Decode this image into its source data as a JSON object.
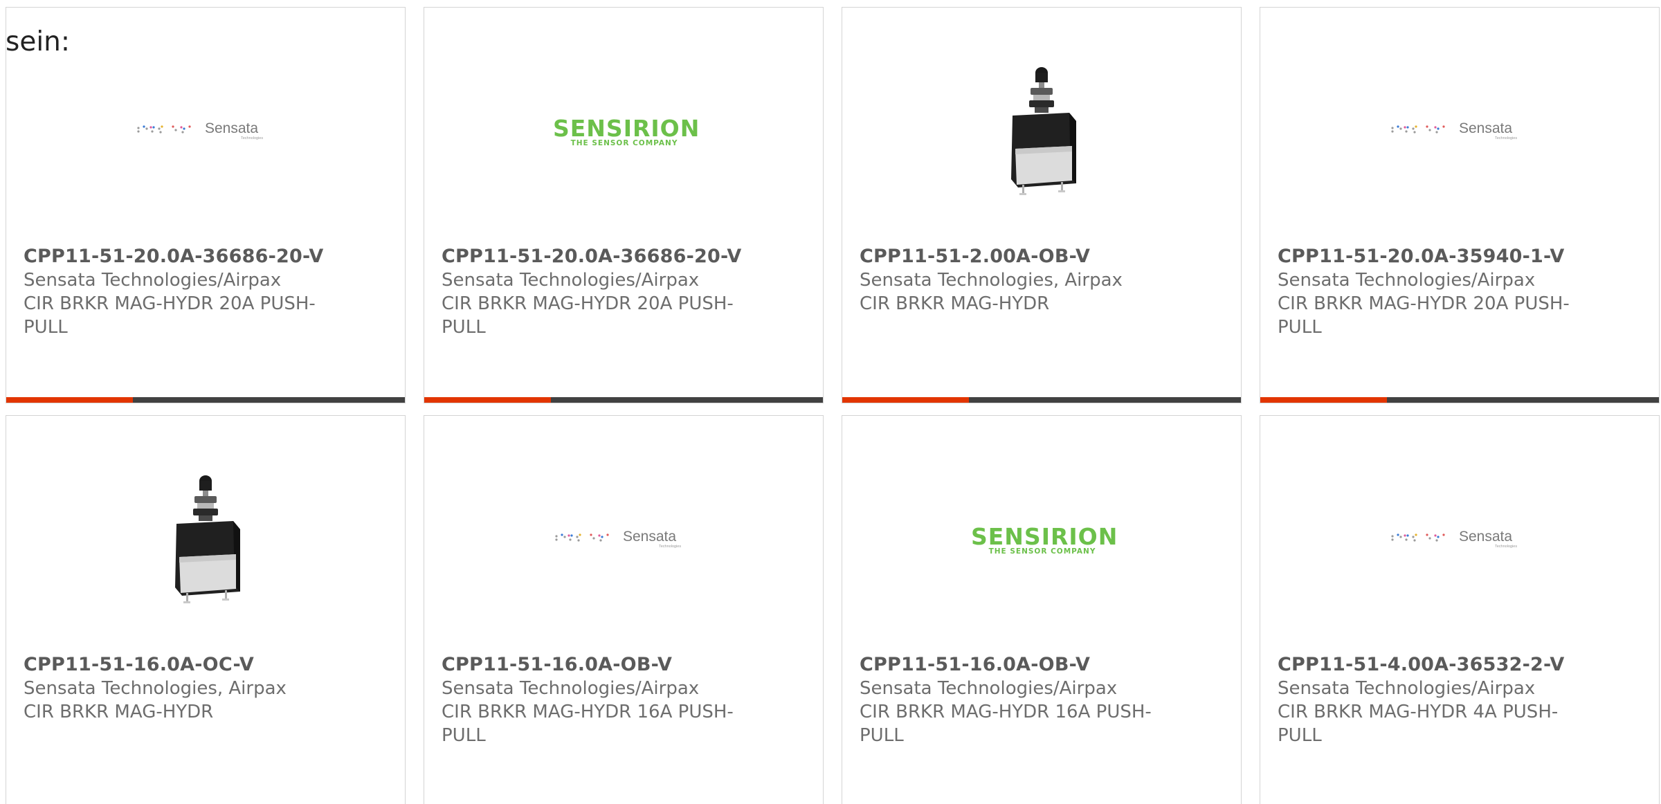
{
  "intro_text": "sein:",
  "colors": {
    "accent_bar": "#e23500",
    "bar": "#414141",
    "sensirion_green": "#6cc04a"
  },
  "logos": {
    "sensata": {
      "name": "Sensata",
      "sub": "Technologies"
    },
    "sensirion": {
      "name": "SENSIRION",
      "tagline": "THE SENSOR COMPANY"
    }
  },
  "products": [
    {
      "image": "sensata-logo",
      "part": "CPP11-51-20.0A-36686-20-V",
      "manufacturer": "Sensata Technologies/Airpax",
      "description": "CIR BRKR MAG-HYDR 20A PUSH-PULL"
    },
    {
      "image": "sensirion-logo",
      "part": "CPP11-51-20.0A-36686-20-V",
      "manufacturer": "Sensata Technologies/Airpax",
      "description": "CIR BRKR MAG-HYDR 20A PUSH-PULL"
    },
    {
      "image": "circuit-breaker-photo",
      "part": "CPP11-51-2.00A-OB-V",
      "manufacturer": "Sensata Technologies, Airpax",
      "description": "CIR BRKR MAG-HYDR"
    },
    {
      "image": "sensata-logo",
      "part": "CPP11-51-20.0A-35940-1-V",
      "manufacturer": "Sensata Technologies/Airpax",
      "description": "CIR BRKR MAG-HYDR 20A PUSH-PULL"
    },
    {
      "image": "circuit-breaker-photo",
      "part": "CPP11-51-16.0A-OC-V",
      "manufacturer": "Sensata Technologies, Airpax",
      "description": "CIR BRKR MAG-HYDR"
    },
    {
      "image": "sensata-logo",
      "part": "CPP11-51-16.0A-OB-V",
      "manufacturer": "Sensata Technologies/Airpax",
      "description": "CIR BRKR MAG-HYDR 16A PUSH-PULL"
    },
    {
      "image": "sensirion-logo",
      "part": "CPP11-51-16.0A-OB-V",
      "manufacturer": "Sensata Technologies/Airpax",
      "description": "CIR BRKR MAG-HYDR 16A PUSH-PULL"
    },
    {
      "image": "sensata-logo",
      "part": "CPP11-51-4.00A-36532-2-V",
      "manufacturer": "Sensata Technologies/Airpax",
      "description": "CIR BRKR MAG-HYDR 4A PUSH-PULL"
    }
  ]
}
